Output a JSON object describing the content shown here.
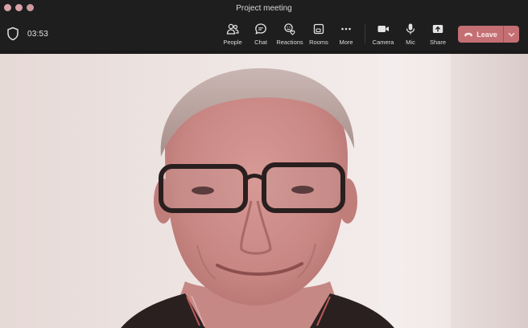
{
  "window": {
    "title": "Project meeting"
  },
  "toolbar": {
    "timer": "03:53",
    "buttons": [
      {
        "label": "People",
        "icon": "people-icon"
      },
      {
        "label": "Chat",
        "icon": "chat-icon"
      },
      {
        "label": "Reactions",
        "icon": "reactions-icon"
      },
      {
        "label": "Rooms",
        "icon": "rooms-icon"
      },
      {
        "label": "More",
        "icon": "more-icon"
      },
      {
        "label": "Camera",
        "icon": "camera-icon"
      },
      {
        "label": "Mic",
        "icon": "mic-icon"
      },
      {
        "label": "Share",
        "icon": "share-icon"
      }
    ],
    "leave_label": "Leave"
  },
  "colors": {
    "leave_button": "#c46f73",
    "toolbar_bg": "#1e1e1e"
  }
}
